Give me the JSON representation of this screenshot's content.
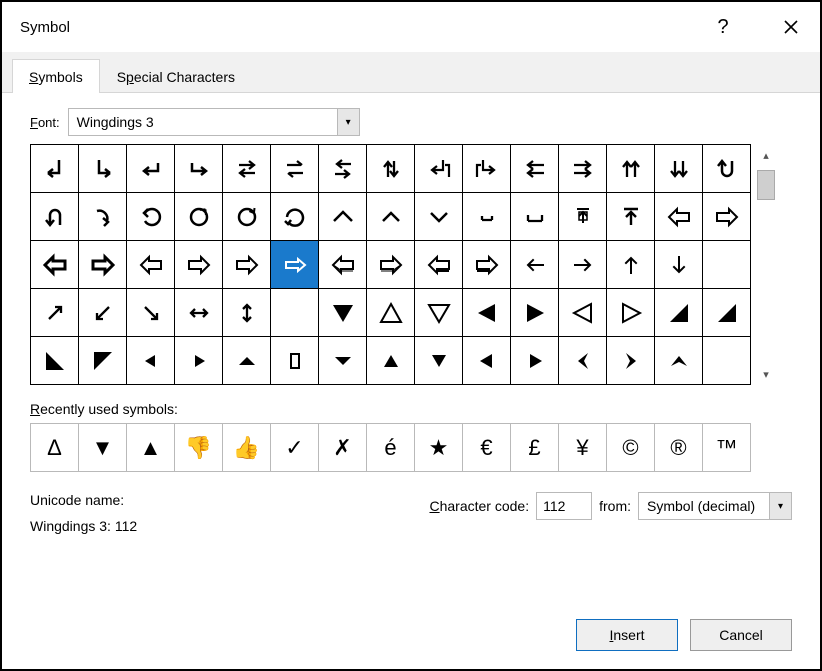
{
  "title": "Symbol",
  "tabs": {
    "symbols": "Symbols",
    "special": "Special Characters"
  },
  "font_label_pre": "F",
  "font_label": "ont:",
  "font_value": "Wingdings 3",
  "recent_label": "Recently used symbols:",
  "recent_u": "R",
  "unicode_label": "Unicode name:",
  "unicode_value": "Wingdings 3: 112",
  "charcode_u": "C",
  "charcode_label": "haracter code:",
  "charcode_value": "112",
  "from_label": "from:",
  "from_value": "Symbol (decimal)",
  "insert_u": "I",
  "insert_label": "nsert",
  "cancel_label": "Cancel",
  "recent": [
    "Δ",
    "▼",
    "▲",
    "👎",
    "👍",
    "✓",
    "✗",
    "é",
    "★",
    "€",
    "£",
    "¥",
    "©",
    "®",
    "™"
  ],
  "selected_index": 35,
  "grid": [
    "down-left",
    "down-right",
    "return-left",
    "return-right",
    "crossing-double",
    "crossing-single",
    "swap-left",
    "up-down",
    "swap-down-left",
    "swap-down-right",
    "double-head-left",
    "double-head-right",
    "up-pair",
    "down-pair",
    "u-turn-down",
    "u-turn-up",
    "curve-right",
    "undo",
    "circle-open",
    "circle-solid",
    "rotate",
    "caret-up-wide",
    "caret-up",
    "caret-down",
    "bracket-down-small",
    "bracket-down",
    "shelf-up-outline",
    "shelf-up",
    "outline-left",
    "outline-right",
    "outline-left-heavy",
    "outline-right-heavy",
    "outline-left-white",
    "outline-right-white",
    "outline-right-white-2",
    "outline-right-slim",
    "outline-left-shadow",
    "outline-right-shadow",
    "outline-left-shadow-2",
    "outline-right-shadow-2",
    "thin-left",
    "thin-right",
    "thin-up",
    "thin-down",
    "blank",
    "diag-up-right",
    "diag-down-left",
    "diag-down-right",
    "left-right",
    "up-down-thin",
    "triangle-up-solid-sel",
    "triangle-down-solid",
    "triangle-up-outline",
    "triangle-down-outline",
    "play-left-solid",
    "play-right-solid",
    "play-left-outline",
    "play-right-outline",
    "wedge-bottom-right",
    "wedge-bottom-right-solid",
    "wedge-bottom-left",
    "wedge-bottom-left-solid",
    "triangle-left-small",
    "triangle-right-small",
    "triangle-up-flat",
    "rect-outline",
    "triangle-down-flat",
    "triangle-up-small",
    "triangle-down-small",
    "triangle-left-small-2",
    "triangle-right-small-2",
    "arrowhead-left",
    "arrowhead-right",
    "arrowhead-up",
    "blank2"
  ]
}
